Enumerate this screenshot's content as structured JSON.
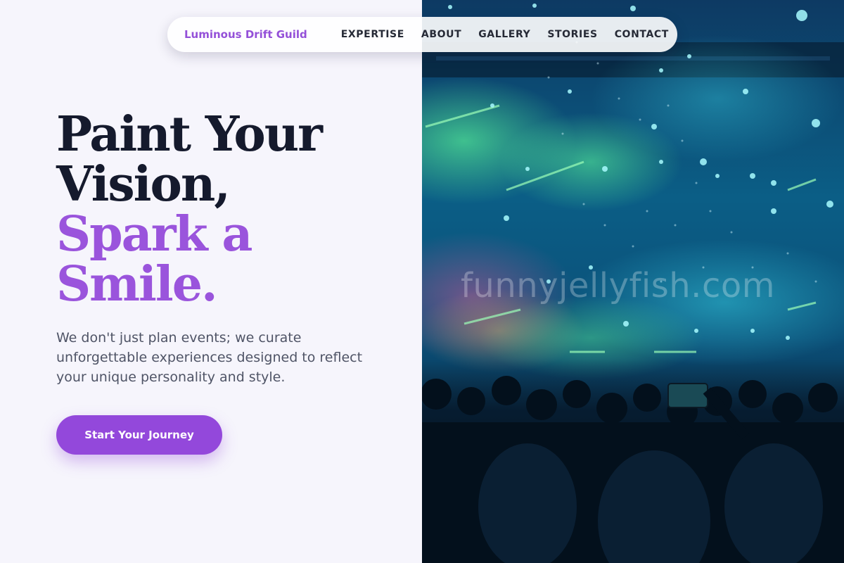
{
  "nav": {
    "brand": "Luminous Drift Guild",
    "links": [
      "EXPERTISE",
      "ABOUT",
      "GALLERY",
      "STORIES",
      "CONTACT"
    ]
  },
  "hero": {
    "headline_line1": "Paint Your",
    "headline_line2": "Vision,",
    "headline_accent1": "Spark a",
    "headline_accent2": "Smile.",
    "subtitle": "We don't just plan events; we curate unforgettable experiences designed to reflect your unique personality and style.",
    "cta_label": "Start Your Journey"
  },
  "image": {
    "subject": "concert-crowd-with-confetti-and-stage-lights",
    "watermark": "funnyjellyfish.com"
  },
  "colors": {
    "accent": "#9a54dc",
    "headline": "#151a2d",
    "background": "#f6f5fc",
    "button": "#9348db"
  }
}
